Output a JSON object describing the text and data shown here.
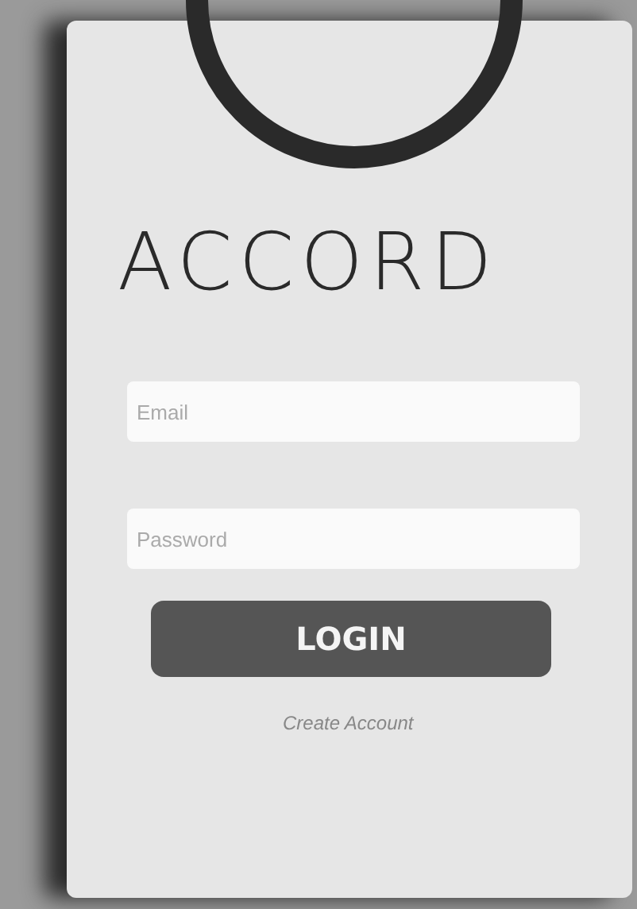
{
  "brand": "ACCORD",
  "fields": [
    {
      "placeholder": "Email"
    },
    {
      "placeholder": "Password"
    }
  ],
  "login_button": "LOGIN",
  "create_account_link": "Create Account"
}
